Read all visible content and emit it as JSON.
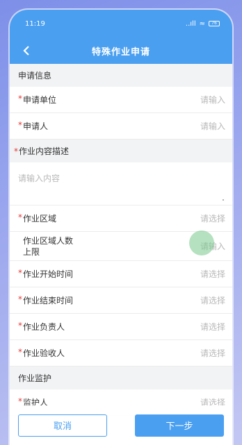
{
  "status_bar": {
    "time": "11:19",
    "signal": "..ıll",
    "wifi": "≈",
    "battery": "76"
  },
  "header": {
    "title": "特殊作业申请",
    "back_icon": "chevron-left-icon"
  },
  "sections": {
    "apply_info": "申请信息",
    "monitor": "作业监护"
  },
  "fields": {
    "apply_unit": {
      "label": "申请单位",
      "value": "请输入",
      "required": true
    },
    "applicant": {
      "label": "申请人",
      "value": "请输入",
      "required": true
    },
    "work_desc": {
      "label": "作业内容描述",
      "placeholder": "请输入内容",
      "required": true
    },
    "work_area": {
      "label": "作业区域",
      "value": "请选择",
      "required": true
    },
    "area_limit": {
      "label": "作业区域人数上限",
      "value": "请输入",
      "required": false
    },
    "start_time": {
      "label": "作业开始时间",
      "value": "请选择",
      "required": true
    },
    "end_time": {
      "label": "作业结束时间",
      "value": "请选择",
      "required": true
    },
    "responsible": {
      "label": "作业负责人",
      "value": "请选择",
      "required": true
    },
    "acceptor": {
      "label": "作业验收人",
      "value": "请选择",
      "required": true
    },
    "guardian": {
      "label": "监护人",
      "value": "请选择",
      "required": true
    }
  },
  "footer": {
    "cancel": "取消",
    "next": "下一步"
  },
  "colors": {
    "primary": "#4a9ff0",
    "required": "#e53935"
  }
}
